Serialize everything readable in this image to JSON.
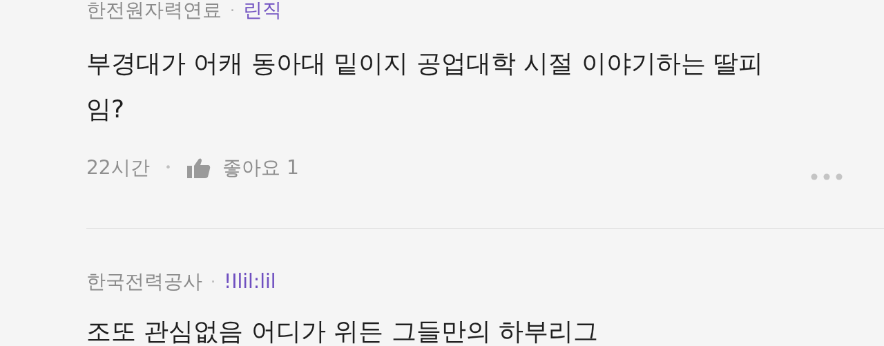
{
  "comments": [
    {
      "company": "한전원자력연료",
      "separator": "·",
      "nickname": "린직",
      "body": "부경대가 어캐 동아대 밑이지 공업대학 시절 이야기하는 딸피임?",
      "time": "22시간",
      "dot": "•",
      "like": "좋아요 1"
    },
    {
      "company": "한국전력공사",
      "separator": "·",
      "nickname": "!Ilil:lil",
      "body": "조또 관심없음 어디가 위든 그들만의 하부리그"
    }
  ]
}
